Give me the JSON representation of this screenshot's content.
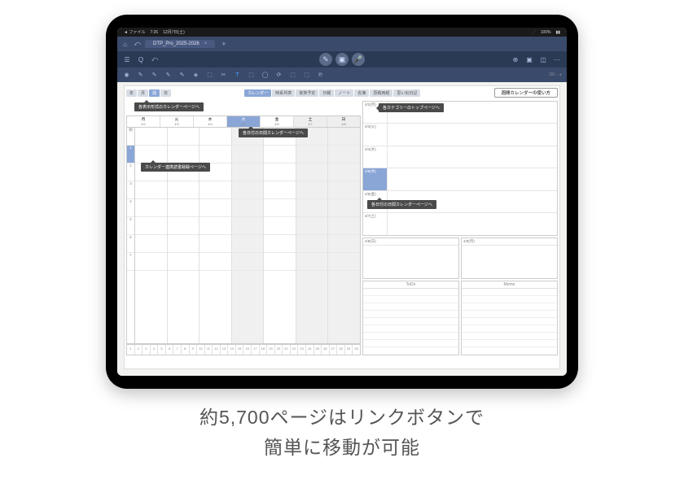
{
  "status": {
    "left": "◄ ファイル",
    "time": "7:26",
    "date": "12月7日(土)",
    "right": "100%",
    "battery": "▮▮"
  },
  "tab": {
    "title": "DTP_Pro_2025-2026",
    "close": "×",
    "plus": "+"
  },
  "toolbar_icons": [
    "☰",
    "Q",
    "⤺"
  ],
  "toolbar_center": [
    "✎",
    "▣",
    "🎤"
  ],
  "toolbar_right": [
    "⊕",
    "▣",
    "◫",
    "⋯"
  ],
  "tool_icons": [
    "◉",
    "✎",
    "✎",
    "✎",
    "✎",
    "◈",
    "⬚",
    "✂",
    "T",
    "⬚",
    "◯",
    "⟳",
    "⬚",
    "⬚",
    "℗"
  ],
  "tool_text_right": "28/… ▸",
  "nav_left": [
    "年",
    "月",
    "週",
    "日"
  ],
  "nav_tabs": [
    "カレンダー",
    "時系列表",
    "家族予定",
    "日報",
    "ノート",
    "名簿",
    "原稿用紙",
    "思い出日記"
  ],
  "nav_right_btn": "週間カレンダーの使い方",
  "callouts": {
    "a": "各表示形式のカレンダーページへ",
    "b": "各日付の日間カレンダーページへ",
    "c": "カレンダー連携読書録録ページへ",
    "d": "各カテゴリーのトップページへ",
    "e": "各日付の日間カレンダーページへ"
  },
  "week": {
    "days": [
      "月",
      "火",
      "水",
      "木",
      "金",
      "土",
      "日"
    ],
    "dates": [
      "4/2",
      "4/3",
      "4/4",
      "4/5",
      "4/6",
      "4/7",
      "4/8"
    ],
    "sel_day_index": 3,
    "hours": [
      "朝",
      "1",
      "2",
      "3",
      "4",
      "5",
      "6",
      "7"
    ],
    "sel_hour_index": 1
  },
  "bottom_days": [
    "1",
    "2",
    "3",
    "4",
    "5",
    "6",
    "7",
    "8",
    "9",
    "10",
    "11",
    "12",
    "13",
    "14",
    "15",
    "16",
    "17",
    "18",
    "19",
    "20",
    "21",
    "22",
    "23",
    "24",
    "25",
    "26",
    "27",
    "28",
    "29",
    "30"
  ],
  "daily": {
    "rows": [
      "4/2(月)",
      "4/3(火)",
      "4/4(水)",
      "4/5(木)",
      "4/6(金)",
      "4/7(土)"
    ],
    "sel_index": 3,
    "bottom_left": "4/8(日)",
    "bottom_right": "4/9(月)"
  },
  "todo_memo": {
    "todo": "ToDo",
    "memo": "Memo"
  },
  "caption_l1": "約5,700ページはリンクボタンで",
  "caption_l2": "簡単に移動が可能"
}
